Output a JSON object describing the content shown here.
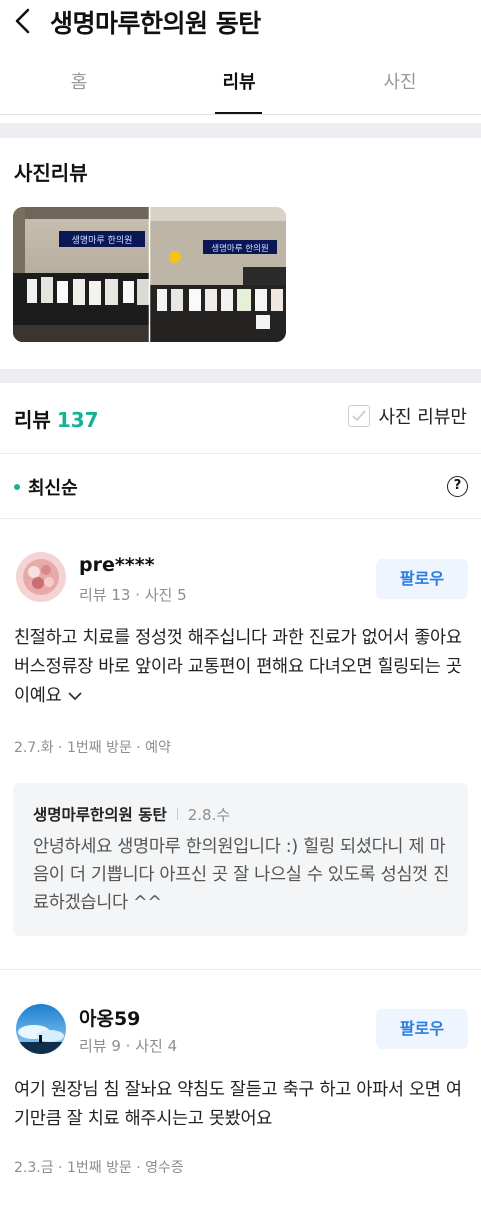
{
  "header": {
    "title": "생명마루한의원 동탄"
  },
  "tabs": [
    {
      "label": "홈"
    },
    {
      "label": "리뷰"
    },
    {
      "label": "사진"
    }
  ],
  "photo_reviews": {
    "title": "사진리뷰",
    "sign_text": "생명마루 한의원"
  },
  "reviews_section": {
    "label": "리뷰",
    "count": "137",
    "photo_only_label": "사진 리뷰만",
    "sort_label": "최신순",
    "help_icon_glyph": "?"
  },
  "accent_color": "#14b391",
  "reviews": [
    {
      "username": "pre****",
      "meta": "리뷰 13 · 사진 5",
      "follow_label": "팔로우",
      "text": "친절하고 치료를 정성껏 해주십니다 과한 진료가 없어서 좋아요 버스정류장 바로 앞이라 교통편이 편해요 다녀오면 힐링되는 곳이예요",
      "visit": "2.7.화 · 1번째 방문 · 예약",
      "reply": {
        "author": "생명마루한의원 동탄",
        "date": "2.8.수",
        "text": "안녕하세요 생명마루 한의원입니다 :) 힐링 되셨다니 제 마음이 더 기쁩니다 아프신 곳 잘 나으실 수 있도록 성심껏 진료하겠습니다 ^^"
      }
    },
    {
      "username": "아옹59",
      "meta": "리뷰 9 · 사진 4",
      "follow_label": "팔로우",
      "text": "여기 원장님 침 잘놔요 약침도 잘듣고 축구 하고 아파서 오면 여기만큼 잘 치료 해주시는고 못봤어요",
      "visit": "2.3.금 · 1번째 방문 · 영수증"
    }
  ]
}
